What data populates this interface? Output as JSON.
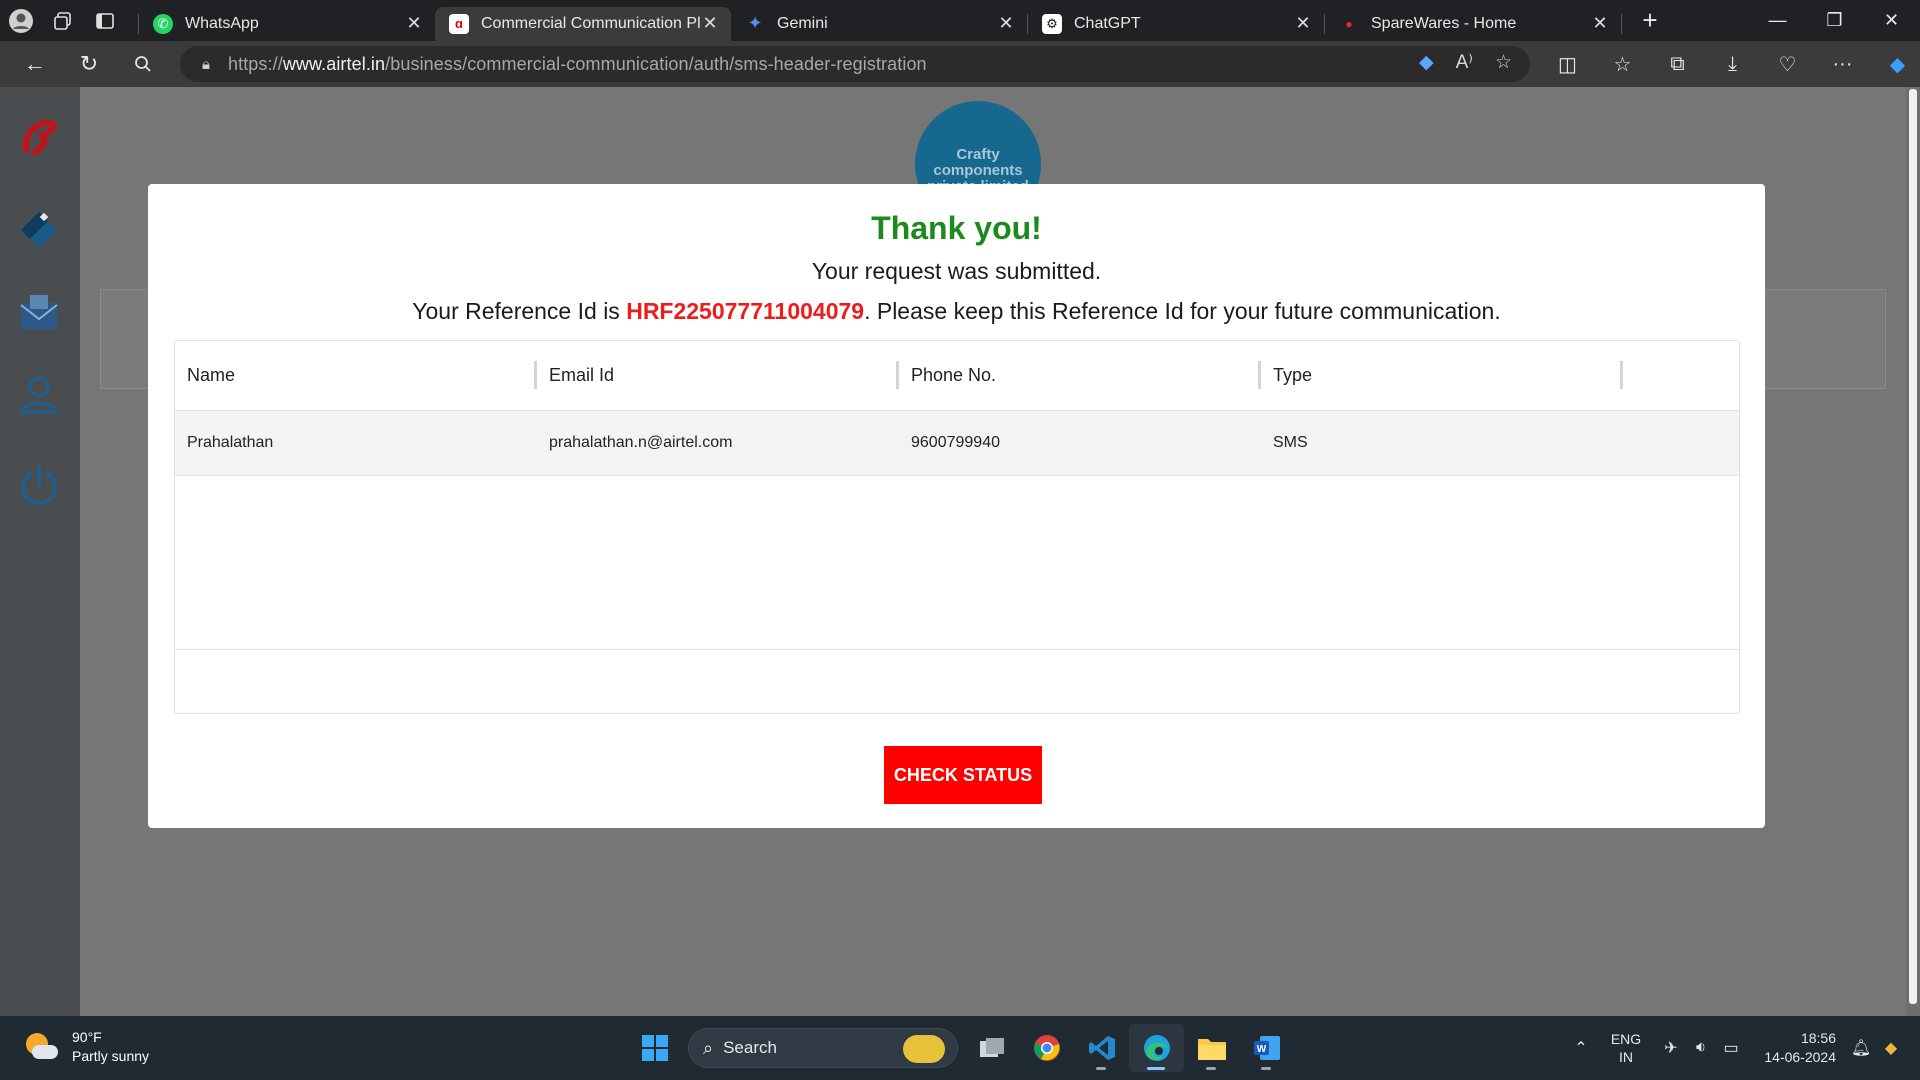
{
  "browser": {
    "tabs": [
      {
        "label": "WhatsApp",
        "active": false,
        "icon": "whatsapp-icon"
      },
      {
        "label": "Commercial Communication Plat",
        "active": true,
        "icon": "airtel-icon"
      },
      {
        "label": "Gemini",
        "active": false,
        "icon": "gemini-icon"
      },
      {
        "label": "ChatGPT",
        "active": false,
        "icon": "chatgpt-icon"
      },
      {
        "label": "SpareWares - Home",
        "active": false,
        "icon": "sparewares-icon"
      }
    ],
    "url_prefix": "https://",
    "url_domain": "www.airtel.in",
    "url_path": "/business/commercial-communication/auth/sms-header-registration"
  },
  "background": {
    "company_logo_text": "Crafty components private limited"
  },
  "modal": {
    "title": "Thank you!",
    "subtitle": "Your request was submitted.",
    "reference_prefix": "Your Reference Id is ",
    "reference_id": "HRF225077711004079",
    "reference_suffix": ". Please keep this Reference Id for your future communication.",
    "table": {
      "headers": [
        "Name",
        "Email Id",
        "Phone No.",
        "Type"
      ],
      "rows": [
        [
          "Prahalathan",
          "prahalathan.n@airtel.com",
          "9600799940",
          "SMS"
        ]
      ]
    },
    "check_status_label": "CHECK STATUS"
  },
  "taskbar": {
    "weather_temp": "90°F",
    "weather_desc": "Partly sunny",
    "search_label": "Search",
    "lang_line1": "ENG",
    "lang_line2": "IN",
    "time": "18:56",
    "date": "14-06-2024"
  },
  "colors": {
    "success_green": "#1c8a1c",
    "reference_red": "#ee1c1c",
    "button_red": "#ff0000"
  }
}
